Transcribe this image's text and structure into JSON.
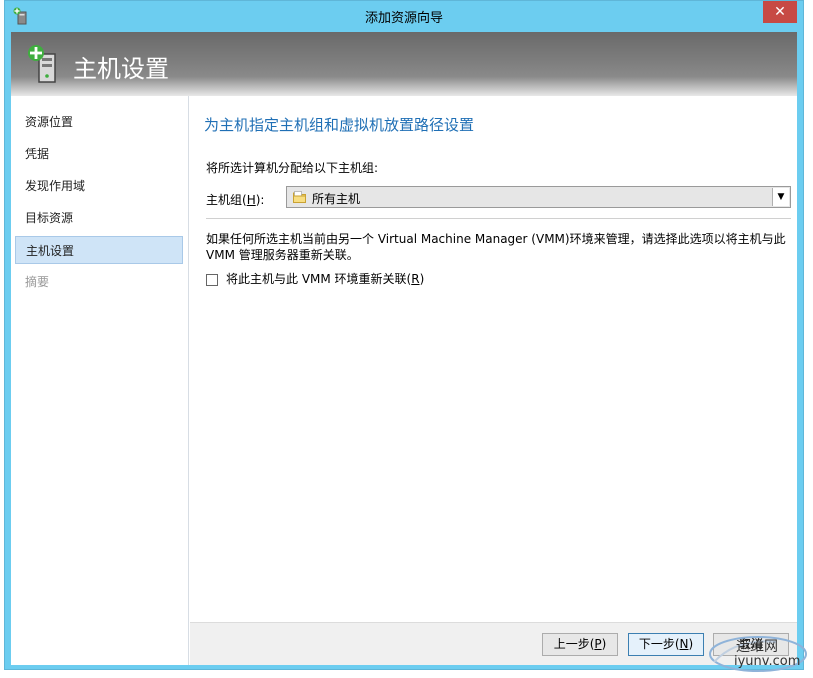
{
  "window": {
    "title": "添加资源向导",
    "close_glyph": "✕"
  },
  "header": {
    "title": "主机设置",
    "icon": "server-add-icon"
  },
  "sidebar": {
    "items": [
      {
        "label": "资源位置",
        "state": "normal"
      },
      {
        "label": "凭据",
        "state": "normal"
      },
      {
        "label": "发现作用域",
        "state": "normal"
      },
      {
        "label": "目标资源",
        "state": "normal"
      },
      {
        "label": "主机设置",
        "state": "active"
      },
      {
        "label": "摘要",
        "state": "disabled"
      }
    ]
  },
  "main": {
    "section_title": "为主机指定主机组和虚拟机放置路径设置",
    "assign_label": "将所选计算机分配给以下主机组:",
    "host_group": {
      "label": "主机组(H):",
      "label_main": "主机组(",
      "label_key": "H",
      "label_end": "):",
      "value": "所有主机",
      "arrow_glyph": "▼"
    },
    "info_text": "如果任何所选主机当前由另一个 Virtual Machine Manager (VMM)环境来管理，请选择此选项以将主机与此 VMM 管理服务器重新关联。",
    "reassociate": {
      "label_main": "将此主机与此 VMM 环境重新关联(",
      "label_key": "R",
      "label_end": ")",
      "checked": false
    }
  },
  "footer": {
    "prev": {
      "main": "上一步(",
      "key": "P",
      "end": ")"
    },
    "next": {
      "main": "下一步(",
      "key": "N",
      "end": ")"
    },
    "cancel": {
      "main": "取消"
    }
  },
  "watermark": {
    "line1": "运维网",
    "line2": "iyunv.com"
  },
  "colors": {
    "accent": "#1f6fb5",
    "titlebar": "#6ccdf0",
    "close": "#c74a44",
    "selected_nav": "#cfe4f7"
  }
}
